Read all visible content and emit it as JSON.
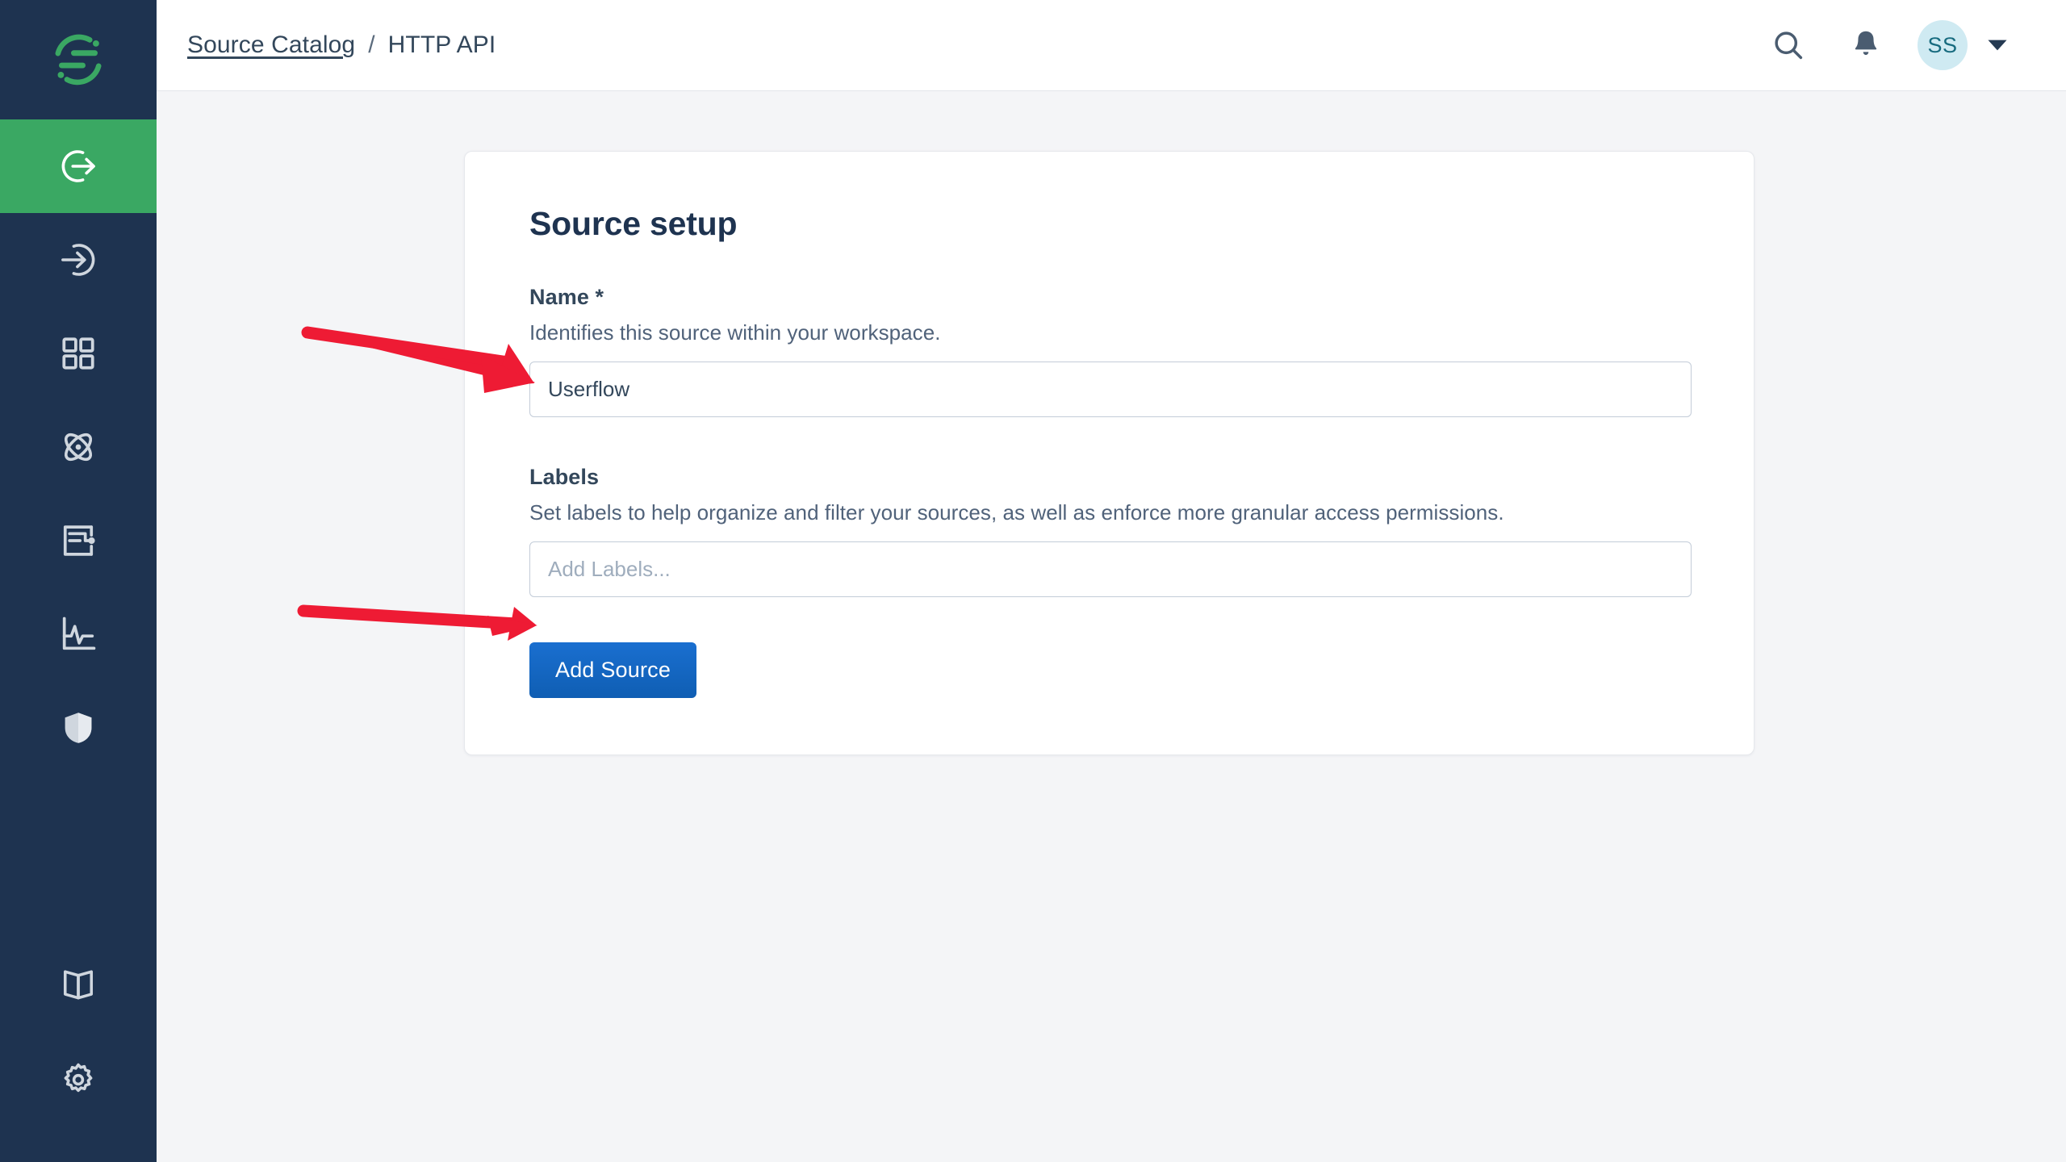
{
  "app": {
    "logo_icon": "stitch-s-logo-icon",
    "brand_color": "#3aa863",
    "sidebar_color": "#1e3350",
    "accent_button_color": "#1565c0",
    "annotation_color": "#ee1b34"
  },
  "sidebar": {
    "items": [
      {
        "name": "sources",
        "icon": "arrow-out-of-circle-icon",
        "active": true
      },
      {
        "name": "destinations",
        "icon": "arrow-into-circle-icon",
        "active": false
      },
      {
        "name": "apps",
        "icon": "grid-squares-icon",
        "active": false
      },
      {
        "name": "integrations",
        "icon": "atom-icon",
        "active": false
      },
      {
        "name": "schema",
        "icon": "schema-node-icon",
        "active": false
      },
      {
        "name": "monitoring",
        "icon": "activity-chart-icon",
        "active": false
      },
      {
        "name": "security",
        "icon": "shield-icon",
        "active": false
      }
    ],
    "bottom_items": [
      {
        "name": "docs",
        "icon": "book-icon"
      },
      {
        "name": "settings",
        "icon": "gear-icon"
      }
    ]
  },
  "header": {
    "breadcrumb": {
      "parent": "Source Catalog",
      "separator": "/",
      "current": "HTTP API"
    },
    "search_icon": "search-icon",
    "notifications_icon": "bell-icon",
    "avatar_initials": "SS",
    "account_caret_icon": "chevron-down-icon"
  },
  "card": {
    "title": "Source setup",
    "name_field": {
      "label": "Name *",
      "description": "Identifies this source within your workspace.",
      "value": "Userflow",
      "placeholder": ""
    },
    "labels_field": {
      "label": "Labels",
      "description": "Set labels to help organize and filter your sources, as well as enforce more granular access permissions.",
      "value": "",
      "placeholder": "Add Labels..."
    },
    "submit_label": "Add Source"
  },
  "annotations": [
    {
      "name": "arrow-to-name-input",
      "target": "name-input"
    },
    {
      "name": "arrow-to-add-source",
      "target": "add-source-button"
    }
  ]
}
